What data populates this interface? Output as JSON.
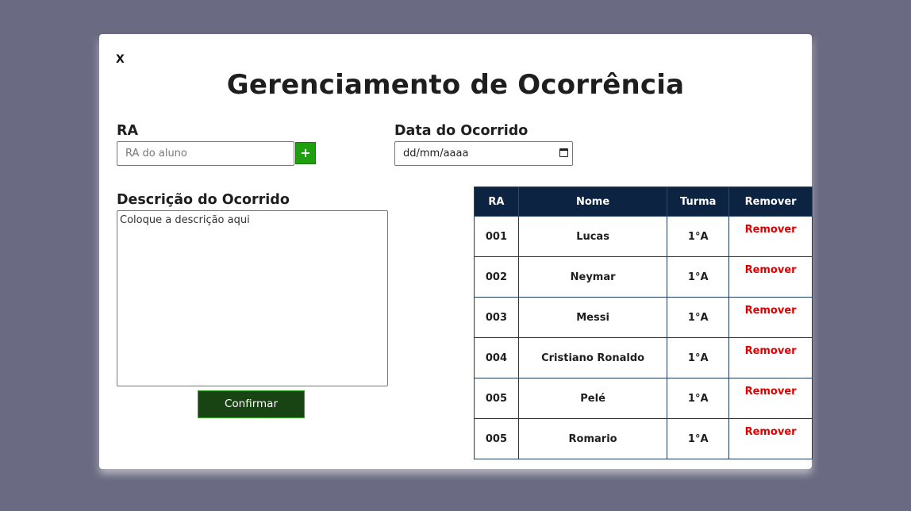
{
  "modal": {
    "close_label": "X",
    "title": "Gerenciamento de Ocorrência"
  },
  "form": {
    "ra_label": "RA",
    "ra_placeholder": "RA do aluno",
    "add_label": "+",
    "date_label": "Data do Ocorrido",
    "date_placeholder": "dd/mm/aaaa",
    "desc_label": "Descrição do Ocorrido",
    "desc_placeholder": "Coloque a descrição aqui",
    "confirm_label": "Confirmar"
  },
  "table": {
    "headers": [
      "RA",
      "Nome",
      "Turma",
      "Remover"
    ],
    "rows": [
      {
        "ra": "001",
        "nome": "Lucas",
        "turma": "1°A",
        "remover": "Remover"
      },
      {
        "ra": "002",
        "nome": "Neymar",
        "turma": "1°A",
        "remover": "Remover"
      },
      {
        "ra": "003",
        "nome": "Messi",
        "turma": "1°A",
        "remover": "Remover"
      },
      {
        "ra": "004",
        "nome": "Cristiano Ronaldo",
        "turma": "1°A",
        "remover": "Remover"
      },
      {
        "ra": "005",
        "nome": "Pelé",
        "turma": "1°A",
        "remover": "Remover"
      },
      {
        "ra": "005",
        "nome": "Romario",
        "turma": "1°A",
        "remover": "Remover"
      }
    ]
  },
  "colors": {
    "backdrop": "#6a6a82",
    "table_header": "#0c2341",
    "add_button": "#1f9e0f",
    "confirm_button": "#174412",
    "remove_link": "#e00000"
  },
  "icons": {
    "date_picker": "calendar-icon"
  }
}
